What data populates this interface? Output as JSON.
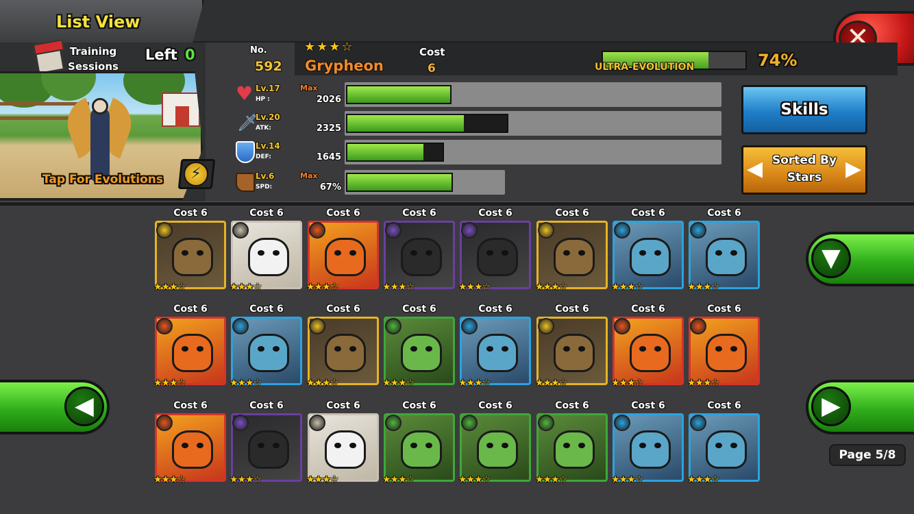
{
  "header": {
    "title": "List View",
    "close_icon": "close-x-icon"
  },
  "training": {
    "label": "Training Sessions",
    "left_label": "Left",
    "left_value": "0"
  },
  "portrait": {
    "tap_label": "Tap For Evolutions",
    "evo_icon": "lightning-icon"
  },
  "monster": {
    "no_label": "No.",
    "number": "592",
    "stars": "★★★☆",
    "name": "Grypheon",
    "cost_label": "Cost",
    "cost": "6",
    "evolution_label": "ULTRA-EVOLUTION",
    "evolution_percent": "74%",
    "evolution_progress": 0.74
  },
  "stats": [
    {
      "icon": "heart-icon",
      "level": "Lv.17",
      "key": "HP :",
      "max": "Max",
      "value": "2026",
      "bar_fill": 1.0,
      "bar_capacity": 0.28
    },
    {
      "icon": "sword-icon",
      "level": "Lv.20",
      "key": "ATK:",
      "max": "",
      "value": "2325",
      "bar_fill": 0.73,
      "bar_capacity": 0.43
    },
    {
      "icon": "shield-icon",
      "level": "Lv.14",
      "key": "DEF:",
      "max": "",
      "value": "1645",
      "bar_fill": 0.8,
      "bar_capacity": 0.26
    },
    {
      "icon": "boot-icon",
      "level": "Lv.6",
      "key": "SPD:",
      "max": "Max",
      "value": "67%",
      "bar_fill": 1.0,
      "bar_capacity": 0.28
    }
  ],
  "buttons": {
    "skills": "Skills",
    "sort": "Sorted By Stars",
    "filter_icon": "filter-funnel-icon",
    "prev_icon": "arrow-left-icon",
    "next_icon": "arrow-right-icon"
  },
  "grid": {
    "cost_label": "Cost 6",
    "rows": [
      [
        {
          "element": "electric",
          "frame": "#e6b422",
          "stars": "★★★☆"
        },
        {
          "element": "neutral",
          "frame": "#c9c1b3",
          "stars": "★★★☆"
        },
        {
          "element": "fire",
          "frame": "#d6332a",
          "stars": "★★★☆"
        },
        {
          "element": "dark",
          "frame": "#6a3fa0",
          "stars": "★★★☆"
        },
        {
          "element": "dark",
          "frame": "#6a3fa0",
          "stars": "★★★☆"
        },
        {
          "element": "electric",
          "frame": "#e6b422",
          "stars": "★★★☆"
        },
        {
          "element": "water",
          "frame": "#2aa3e0",
          "stars": "★★★☆"
        },
        {
          "element": "water",
          "frame": "#2aa3e0",
          "stars": "★★★☆"
        }
      ],
      [
        {
          "element": "fire",
          "frame": "#d6332a",
          "stars": "★★★☆"
        },
        {
          "element": "water",
          "frame": "#2aa3e0",
          "stars": "★★★☆"
        },
        {
          "element": "electric",
          "frame": "#e6b422",
          "stars": "★★★☆"
        },
        {
          "element": "grass",
          "frame": "#3fa83a",
          "stars": "★★★☆"
        },
        {
          "element": "water",
          "frame": "#2aa3e0",
          "stars": "★★★☆"
        },
        {
          "element": "electric",
          "frame": "#e6b422",
          "stars": "★★★☆"
        },
        {
          "element": "fire",
          "frame": "#d6332a",
          "stars": "★★★☆"
        },
        {
          "element": "fire",
          "frame": "#d6332a",
          "stars": "★★★☆"
        }
      ],
      [
        {
          "element": "fire",
          "frame": "#d6332a",
          "stars": "★★★☆"
        },
        {
          "element": "dark",
          "frame": "#6a3fa0",
          "stars": "★★★☆"
        },
        {
          "element": "neutral",
          "frame": "#c9c1b3",
          "stars": "★★★☆"
        },
        {
          "element": "grass",
          "frame": "#3fa83a",
          "stars": "★★★☆"
        },
        {
          "element": "grass",
          "frame": "#3fa83a",
          "stars": "★★★☆"
        },
        {
          "element": "grass",
          "frame": "#3fa83a",
          "stars": "★★★☆"
        },
        {
          "element": "water",
          "frame": "#2aa3e0",
          "stars": "★★★☆"
        },
        {
          "element": "water",
          "frame": "#2aa3e0",
          "stars": "★★★☆"
        }
      ]
    ]
  },
  "pagination": {
    "label": "Page 5/8"
  }
}
